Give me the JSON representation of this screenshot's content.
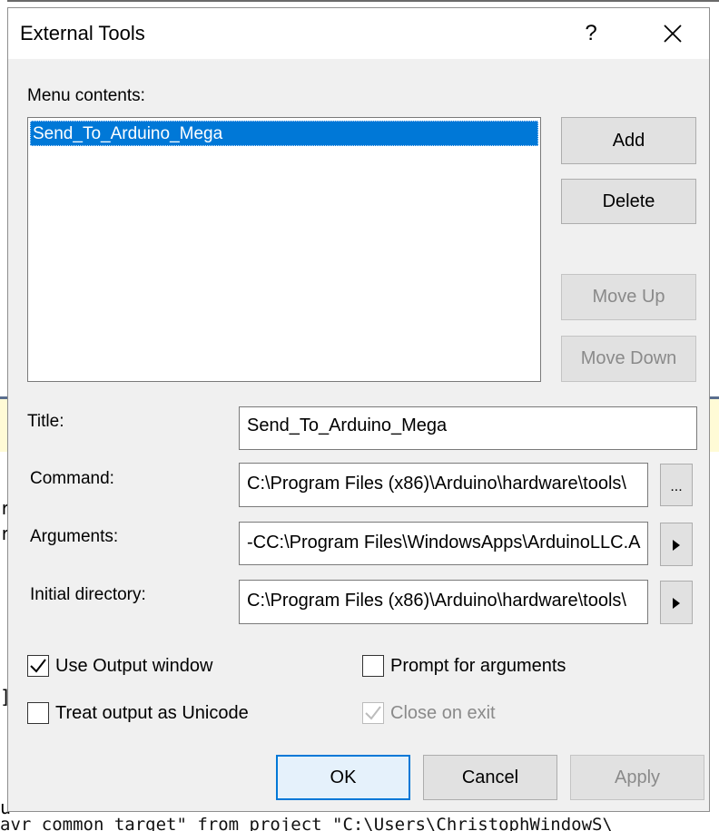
{
  "dialog": {
    "title": "External Tools",
    "help_glyph": "?",
    "menu_contents_label": "Menu contents:",
    "menu_items": [
      "Send_To_Arduino_Mega"
    ],
    "buttons": {
      "add": "Add",
      "delete": "Delete",
      "move_up": "Move Up",
      "move_down": "Move Down",
      "ok": "OK",
      "cancel": "Cancel",
      "apply": "Apply"
    },
    "fields": {
      "title": {
        "label": "Title:",
        "value": "Send_To_Arduino_Mega"
      },
      "command": {
        "label": "Command:",
        "value": "C:\\Program Files (x86)\\Arduino\\hardware\\tools\\",
        "browse": "..."
      },
      "arguments": {
        "label": "Arguments:",
        "value": "-CC:\\Program Files\\WindowsApps\\ArduinoLLC.A"
      },
      "initial_directory": {
        "label": "Initial directory:",
        "value": "C:\\Program Files (x86)\\Arduino\\hardware\\tools\\"
      }
    },
    "options": {
      "use_output_window": {
        "label": "Use Output window",
        "checked": true
      },
      "prompt_for_arguments": {
        "label": "Prompt for arguments",
        "checked": false
      },
      "treat_output_as_unicode": {
        "label": "Treat output as Unicode",
        "checked": false
      },
      "close_on_exit": {
        "label": "Close on exit",
        "checked": true,
        "disabled": true
      }
    }
  },
  "background": {
    "left_chars": [
      "r",
      "r",
      "]",
      "u"
    ],
    "bottom_line": "avr common target\" from project \"C:\\Users\\ChristophWindowS\\"
  },
  "colors": {
    "selection": "#0078d7",
    "dialog_bg": "#f0f0f0",
    "default_button_border": "#0078d7"
  }
}
